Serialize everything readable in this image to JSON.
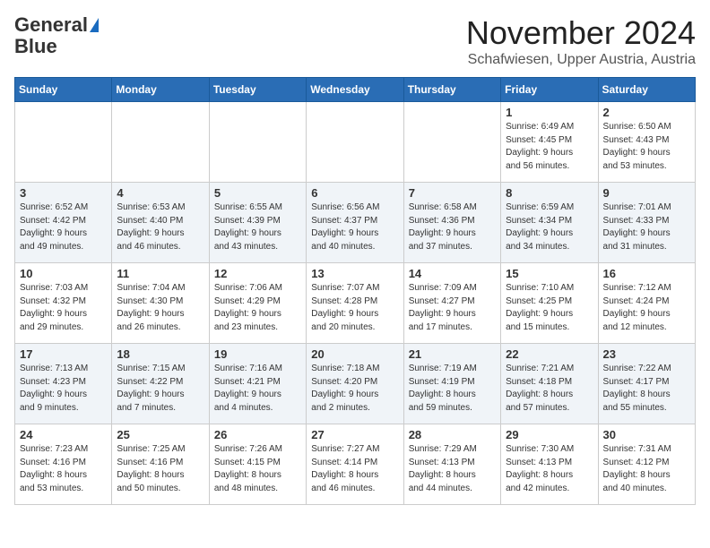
{
  "header": {
    "logo_line1": "General",
    "logo_line2": "Blue",
    "month": "November 2024",
    "location": "Schafwiesen, Upper Austria, Austria"
  },
  "days_of_week": [
    "Sunday",
    "Monday",
    "Tuesday",
    "Wednesday",
    "Thursday",
    "Friday",
    "Saturday"
  ],
  "weeks": [
    [
      {
        "day": "",
        "info": ""
      },
      {
        "day": "",
        "info": ""
      },
      {
        "day": "",
        "info": ""
      },
      {
        "day": "",
        "info": ""
      },
      {
        "day": "",
        "info": ""
      },
      {
        "day": "1",
        "info": "Sunrise: 6:49 AM\nSunset: 4:45 PM\nDaylight: 9 hours\nand 56 minutes."
      },
      {
        "day": "2",
        "info": "Sunrise: 6:50 AM\nSunset: 4:43 PM\nDaylight: 9 hours\nand 53 minutes."
      }
    ],
    [
      {
        "day": "3",
        "info": "Sunrise: 6:52 AM\nSunset: 4:42 PM\nDaylight: 9 hours\nand 49 minutes."
      },
      {
        "day": "4",
        "info": "Sunrise: 6:53 AM\nSunset: 4:40 PM\nDaylight: 9 hours\nand 46 minutes."
      },
      {
        "day": "5",
        "info": "Sunrise: 6:55 AM\nSunset: 4:39 PM\nDaylight: 9 hours\nand 43 minutes."
      },
      {
        "day": "6",
        "info": "Sunrise: 6:56 AM\nSunset: 4:37 PM\nDaylight: 9 hours\nand 40 minutes."
      },
      {
        "day": "7",
        "info": "Sunrise: 6:58 AM\nSunset: 4:36 PM\nDaylight: 9 hours\nand 37 minutes."
      },
      {
        "day": "8",
        "info": "Sunrise: 6:59 AM\nSunset: 4:34 PM\nDaylight: 9 hours\nand 34 minutes."
      },
      {
        "day": "9",
        "info": "Sunrise: 7:01 AM\nSunset: 4:33 PM\nDaylight: 9 hours\nand 31 minutes."
      }
    ],
    [
      {
        "day": "10",
        "info": "Sunrise: 7:03 AM\nSunset: 4:32 PM\nDaylight: 9 hours\nand 29 minutes."
      },
      {
        "day": "11",
        "info": "Sunrise: 7:04 AM\nSunset: 4:30 PM\nDaylight: 9 hours\nand 26 minutes."
      },
      {
        "day": "12",
        "info": "Sunrise: 7:06 AM\nSunset: 4:29 PM\nDaylight: 9 hours\nand 23 minutes."
      },
      {
        "day": "13",
        "info": "Sunrise: 7:07 AM\nSunset: 4:28 PM\nDaylight: 9 hours\nand 20 minutes."
      },
      {
        "day": "14",
        "info": "Sunrise: 7:09 AM\nSunset: 4:27 PM\nDaylight: 9 hours\nand 17 minutes."
      },
      {
        "day": "15",
        "info": "Sunrise: 7:10 AM\nSunset: 4:25 PM\nDaylight: 9 hours\nand 15 minutes."
      },
      {
        "day": "16",
        "info": "Sunrise: 7:12 AM\nSunset: 4:24 PM\nDaylight: 9 hours\nand 12 minutes."
      }
    ],
    [
      {
        "day": "17",
        "info": "Sunrise: 7:13 AM\nSunset: 4:23 PM\nDaylight: 9 hours\nand 9 minutes."
      },
      {
        "day": "18",
        "info": "Sunrise: 7:15 AM\nSunset: 4:22 PM\nDaylight: 9 hours\nand 7 minutes."
      },
      {
        "day": "19",
        "info": "Sunrise: 7:16 AM\nSunset: 4:21 PM\nDaylight: 9 hours\nand 4 minutes."
      },
      {
        "day": "20",
        "info": "Sunrise: 7:18 AM\nSunset: 4:20 PM\nDaylight: 9 hours\nand 2 minutes."
      },
      {
        "day": "21",
        "info": "Sunrise: 7:19 AM\nSunset: 4:19 PM\nDaylight: 8 hours\nand 59 minutes."
      },
      {
        "day": "22",
        "info": "Sunrise: 7:21 AM\nSunset: 4:18 PM\nDaylight: 8 hours\nand 57 minutes."
      },
      {
        "day": "23",
        "info": "Sunrise: 7:22 AM\nSunset: 4:17 PM\nDaylight: 8 hours\nand 55 minutes."
      }
    ],
    [
      {
        "day": "24",
        "info": "Sunrise: 7:23 AM\nSunset: 4:16 PM\nDaylight: 8 hours\nand 53 minutes."
      },
      {
        "day": "25",
        "info": "Sunrise: 7:25 AM\nSunset: 4:16 PM\nDaylight: 8 hours\nand 50 minutes."
      },
      {
        "day": "26",
        "info": "Sunrise: 7:26 AM\nSunset: 4:15 PM\nDaylight: 8 hours\nand 48 minutes."
      },
      {
        "day": "27",
        "info": "Sunrise: 7:27 AM\nSunset: 4:14 PM\nDaylight: 8 hours\nand 46 minutes."
      },
      {
        "day": "28",
        "info": "Sunrise: 7:29 AM\nSunset: 4:13 PM\nDaylight: 8 hours\nand 44 minutes."
      },
      {
        "day": "29",
        "info": "Sunrise: 7:30 AM\nSunset: 4:13 PM\nDaylight: 8 hours\nand 42 minutes."
      },
      {
        "day": "30",
        "info": "Sunrise: 7:31 AM\nSunset: 4:12 PM\nDaylight: 8 hours\nand 40 minutes."
      }
    ]
  ]
}
